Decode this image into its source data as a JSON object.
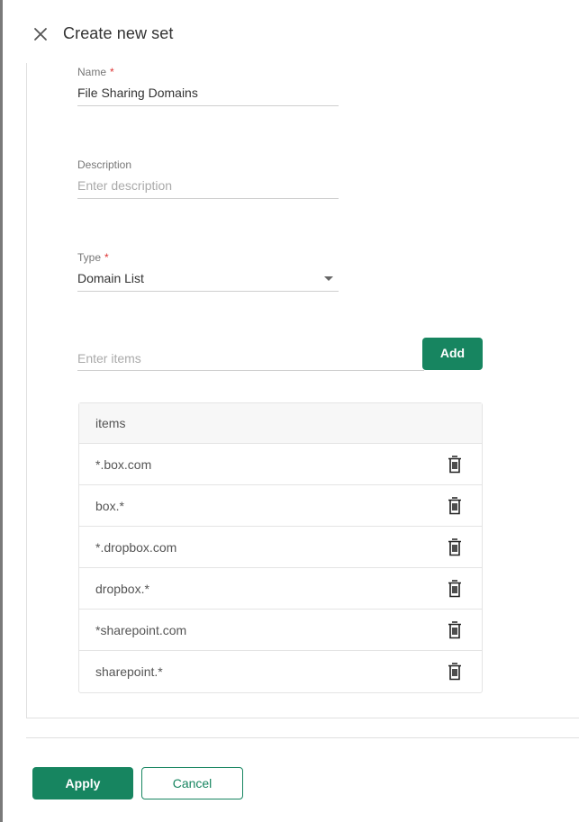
{
  "header": {
    "title": "Create new set"
  },
  "form": {
    "name": {
      "label": "Name",
      "value": "File Sharing Domains"
    },
    "description": {
      "label": "Description",
      "placeholder": "Enter description"
    },
    "type": {
      "label": "Type",
      "value": "Domain List"
    }
  },
  "items_input": {
    "placeholder": "Enter items",
    "add_label": "Add"
  },
  "items_table": {
    "header": "items",
    "rows": [
      "*.box.com",
      "box.*",
      "*.dropbox.com",
      "dropbox.*",
      "*sharepoint.com",
      "sharepoint.*"
    ]
  },
  "footer": {
    "apply_label": "Apply",
    "cancel_label": "Cancel"
  },
  "colors": {
    "accent": "#178560",
    "required": "#dd3333"
  },
  "icons": {
    "close": "close-icon",
    "dropdown": "chevron-down-icon",
    "delete": "trash-icon"
  }
}
